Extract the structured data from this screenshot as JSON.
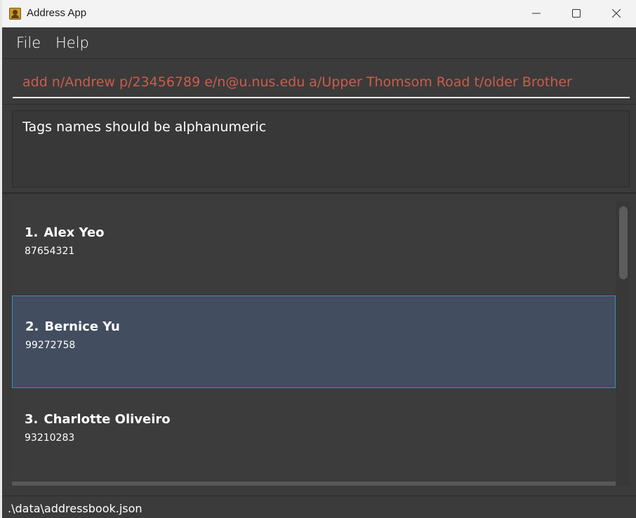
{
  "window": {
    "title": "Address App",
    "icon": "address-book-icon",
    "controls": [
      "minimize-icon",
      "maximize-icon",
      "close-icon"
    ]
  },
  "menu": {
    "items": [
      "File",
      "Help"
    ]
  },
  "command_box": {
    "value": "add n/Andrew p/23456789 e/n@u.nus.edu a/Upper Thomsom Road t/older Brother",
    "text_color": "#cd5c4a"
  },
  "result_display": {
    "message": "Tags names should be alphanumeric"
  },
  "person_list": {
    "selected_index": 1,
    "persons": [
      {
        "index": "1.",
        "name": "Alex Yeo",
        "phone": "87654321"
      },
      {
        "index": "2.",
        "name": "Bernice Yu",
        "phone": "99272758"
      },
      {
        "index": "3.",
        "name": "Charlotte Oliveiro",
        "phone": "93210283"
      }
    ]
  },
  "status_bar": {
    "path": ".\\data\\addressbook.json"
  },
  "colors": {
    "background": "#3b3b3b",
    "selected_card": "#424d5f",
    "selected_border": "#3d8fb6"
  }
}
